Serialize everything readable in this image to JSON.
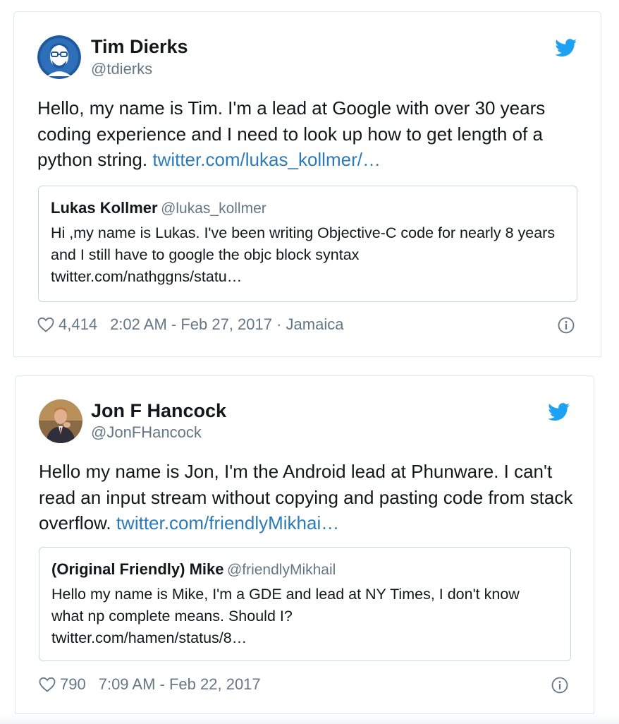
{
  "tweets": [
    {
      "author": "Tim Dierks",
      "handle": "@tdierks",
      "text": "Hello, my name is Tim. I'm a lead at Google with over 30 years coding experience and I need to look up how to get length of a python string. ",
      "link": "twitter.com/lukas_kollmer/…",
      "quote": {
        "author": "Lukas Kollmer",
        "handle": "@lukas_kollmer",
        "text": "Hi ,my name is Lukas. I've been writing Objective-C code for nearly 8 years and I still have to google the objc block syntax",
        "link": "twitter.com/nathggns/statu…"
      },
      "likes": "4,414",
      "timestamp": "2:02 AM - Feb 27, 2017 · Jamaica"
    },
    {
      "author": "Jon F Hancock",
      "handle": "@JonFHancock",
      "text": "Hello my name is Jon, I'm the Android lead at Phunware. I can't read an input stream without copying and pasting code from stack overflow. ",
      "link": "twitter.com/friendlyMikhai…",
      "quote": {
        "author": "(Original Friendly) Mike",
        "handle": "@friendlyMikhail",
        "text": "Hello my name is Mike, I'm a GDE and lead at NY Times, I don't know what np complete means. Should I?",
        "link": "twitter.com/hamen/status/8…"
      },
      "likes": "790",
      "timestamp": "7:09 AM - Feb 22, 2017"
    }
  ],
  "colors": {
    "link": "#2b7bb9",
    "muted": "#657786",
    "twitter_blue": "#1da1f2",
    "border": "#e1e8ed"
  },
  "icons": [
    "twitter-bird-icon",
    "heart-icon",
    "info-icon"
  ]
}
